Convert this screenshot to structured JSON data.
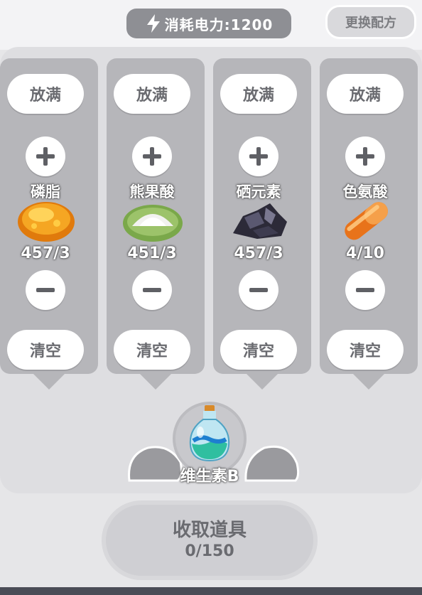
{
  "header": {
    "power_label": "消耗电力:1200",
    "swap_recipe_label": "更换配方"
  },
  "ingredients": [
    {
      "name": "磷脂",
      "count": "457/3",
      "fill_label": "放满",
      "clear_label": "清空",
      "icon": "golden-cake-icon"
    },
    {
      "name": "熊果酸",
      "count": "451/3",
      "fill_label": "放满",
      "clear_label": "清空",
      "icon": "white-powder-icon"
    },
    {
      "name": "硒元素",
      "count": "457/3",
      "fill_label": "放满",
      "clear_label": "清空",
      "icon": "dark-ore-icon"
    },
    {
      "name": "色氨酸",
      "count": "4/10",
      "fill_label": "放满",
      "clear_label": "清空",
      "icon": "capsule-icon"
    }
  ],
  "product": {
    "name": "维生素B",
    "icon": "potion-bottle-icon"
  },
  "collect": {
    "label": "收取道具",
    "count": "0/150"
  },
  "colors": {
    "panel": "#dedee1",
    "column": "#b6b6ba",
    "button": "#ffffff",
    "pill": "#8e8f94"
  }
}
